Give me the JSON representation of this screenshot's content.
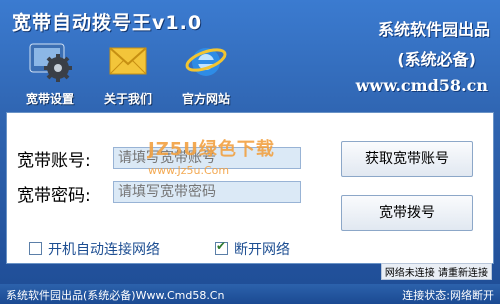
{
  "window": {
    "title": "宽带自动拨号王v1.0",
    "brand_line1": "系统软件园出品",
    "brand_line2": "(系统必备)",
    "brand_url": "www.cmd58.cn"
  },
  "toolbar": [
    {
      "label": "宽带设置",
      "icon": "gear-icon"
    },
    {
      "label": "关于我们",
      "icon": "envelope-icon"
    },
    {
      "label": "官方网站",
      "icon": "internet-explorer-icon"
    }
  ],
  "form": {
    "account_label": "宽带账号:",
    "account_placeholder": "请填写宽带账号",
    "password_label": "宽带密码:",
    "password_placeholder": "请填写宽带密码"
  },
  "buttons": {
    "get_account": "获取宽带账号",
    "dial": "宽带拨号"
  },
  "options": {
    "autostart": {
      "label": "开机自动连接网络",
      "checked": false
    },
    "disconnect": {
      "label": "断开网络",
      "checked": true
    }
  },
  "watermark": {
    "text": "JZ5U绿色下载",
    "url": "www.Jz5u.Com"
  },
  "status_message": "网络未连接 请重新连接",
  "statusbar": {
    "left": "系统软件园出品(系统必备)Www.Cmd58.Cn",
    "right": "连接状态:网络断开"
  },
  "colors": {
    "background": "#2f64b0",
    "panel": "#ffffff",
    "field": "#dbe9f6",
    "watermark": "#f2a142"
  }
}
